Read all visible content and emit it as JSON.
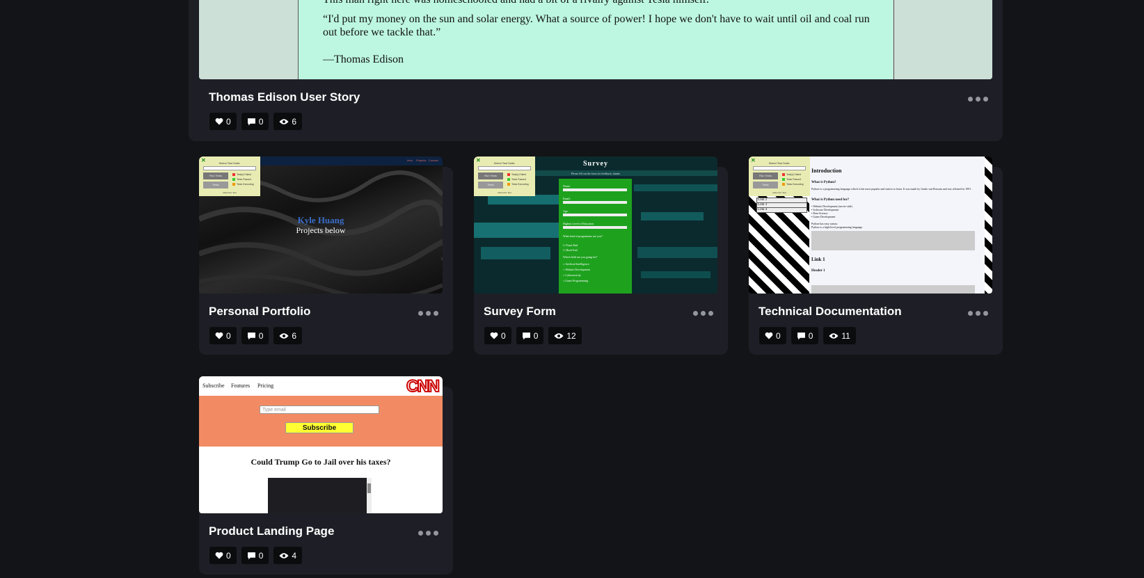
{
  "cards": [
    {
      "title": "Thomas Edison User Story",
      "likes": "0",
      "comments": "0",
      "views": "6",
      "preview": {
        "line_top": "This man right here was homeschooled and had a bit of a rivalry against Tesla himself.",
        "quote": "“I'd put my money on the sun and solar energy. What a source of power! I hope we don't have to wait until oil and coal run out before we tackle that.”",
        "author": "—Thomas Edison"
      }
    },
    {
      "title": "Personal Portfolio",
      "likes": "0",
      "comments": "0",
      "views": "6",
      "preview": {
        "name": "Kyle Huang",
        "subtitle": "Projects below",
        "nav": [
          "Intro",
          "Projects",
          "Contact"
        ]
      }
    },
    {
      "title": "Survey Form",
      "likes": "0",
      "comments": "0",
      "views": "12",
      "preview": {
        "heading": "Survey",
        "intro": "Please fill out the form for feedback, thanks",
        "labels": [
          "Name:",
          "Email:",
          "Age:",
          "Highest Level of Education",
          "What kind of programmer are you?"
        ],
        "checks": [
          "Front-End",
          "Back-End"
        ],
        "field_label": "Which field are you going for?",
        "fields": [
          "Artificial Intelligence",
          "Website Development",
          "Cybersecurity",
          "Game Programming"
        ]
      }
    },
    {
      "title": "Technical Documentation",
      "likes": "0",
      "comments": "0",
      "views": "11",
      "preview": {
        "intro_heading": "Introduction",
        "what_heading": "What is Python?",
        "what_text": "Python is a programming language which is the most popular and easiest to learn. It was made by Guido van Rossum and was released in 1991.",
        "used_heading": "What is Python used for?",
        "uses": [
          "Website Development (server-side)",
          "Software Development",
          "Data Science",
          "Game Development"
        ],
        "syntax_text": "Python has easy syntax.",
        "syntax_text2": "Python is a high-level programming language.",
        "link_heading": "Link 1",
        "header_heading": "Header 1",
        "nav_links": [
          "Link 2",
          "Link 3",
          "Link 4"
        ]
      }
    },
    {
      "title": "Product Landing Page",
      "likes": "0",
      "comments": "0",
      "views": "4",
      "preview": {
        "nav": [
          "Subscribe",
          "Features",
          "Pricing"
        ],
        "logo": "CNN",
        "email_placeholder": "Type email",
        "subscribe": "Subscribe",
        "headline": "Could Trump Go to Jail over his taxes?"
      }
    }
  ],
  "test_suite": {
    "title": "Select Test Suite:",
    "run": "Run Tests",
    "tests": "Tests",
    "legend": [
      "Test(s) Failed",
      "Tests Passed",
      "Tests Executing"
    ],
    "footer": "Hide FCC Test"
  },
  "colors": {
    "background": "#131417",
    "card": "#1e1f26",
    "stat": "#0b0c0e",
    "mint": "#bdf7e1"
  }
}
